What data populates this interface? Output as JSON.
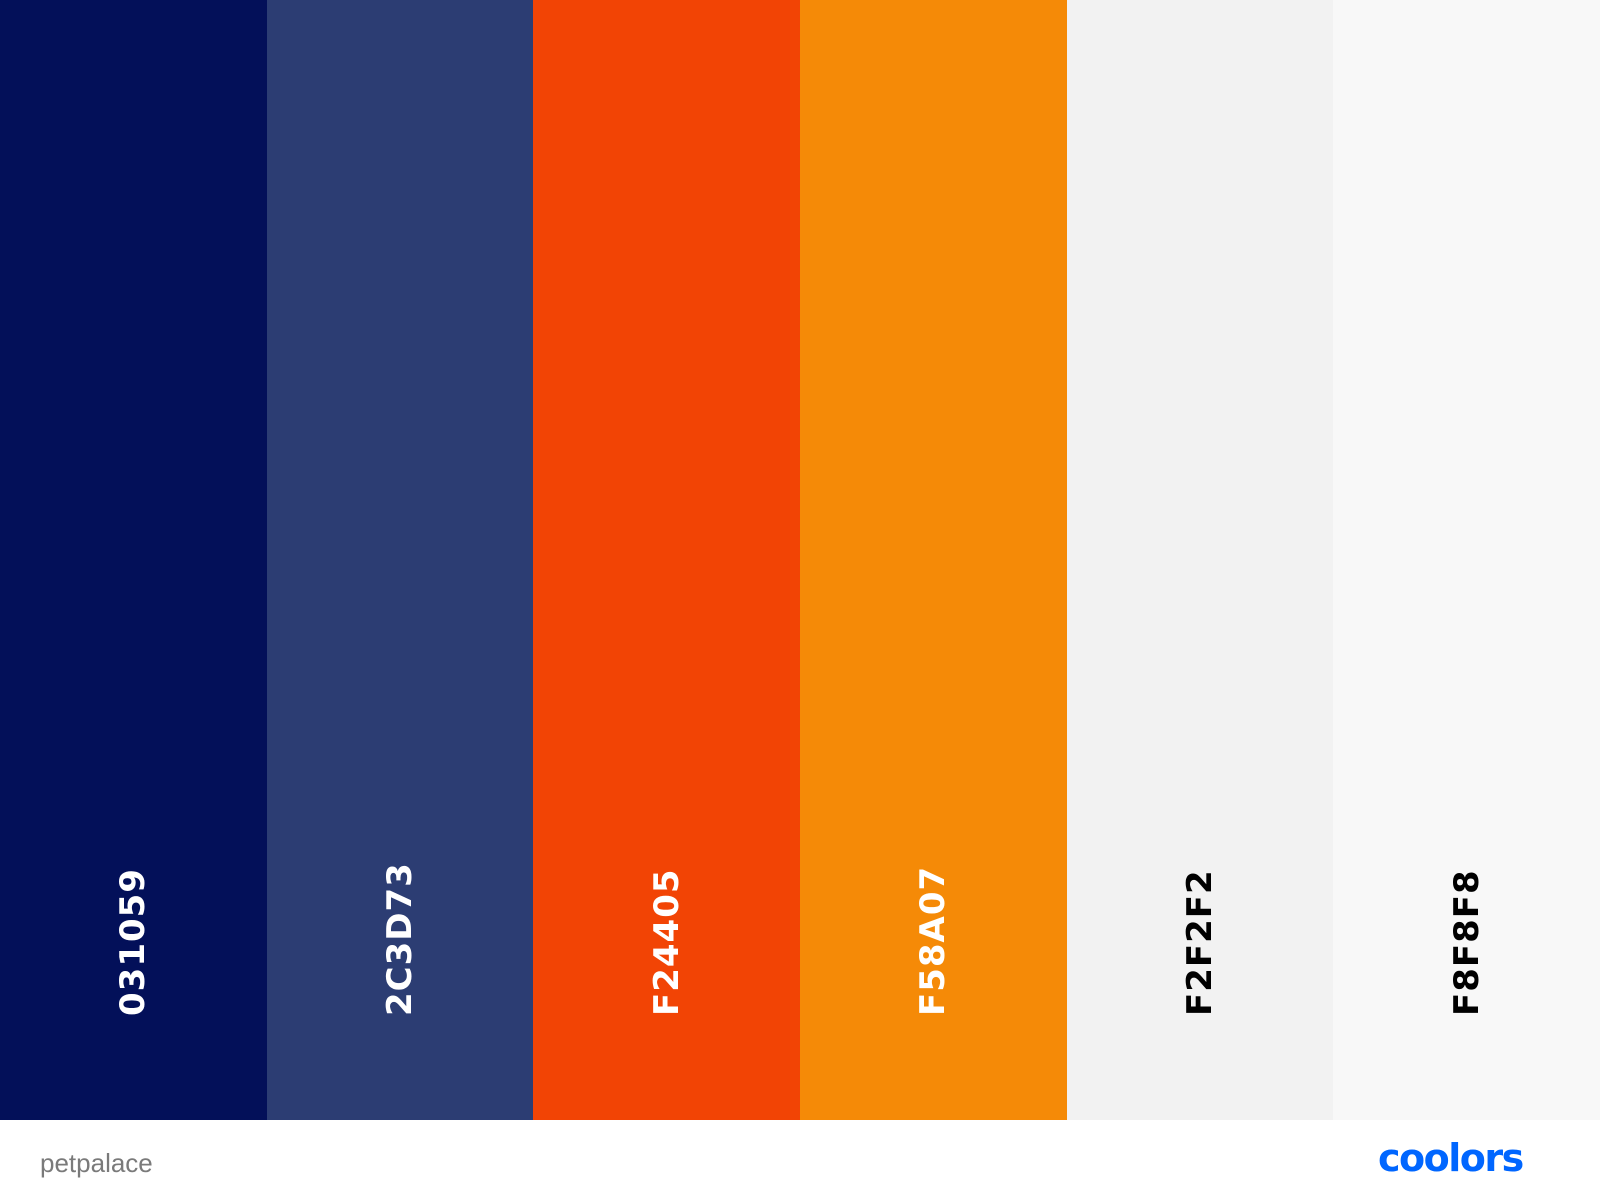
{
  "palette": {
    "swatches": [
      {
        "hex": "031059",
        "color": "#031059",
        "text_color": "#ffffff"
      },
      {
        "hex": "2C3D73",
        "color": "#2C3D73",
        "text_color": "#ffffff"
      },
      {
        "hex": "F24405",
        "color": "#F24405",
        "text_color": "#ffffff"
      },
      {
        "hex": "F58A07",
        "color": "#F58A07",
        "text_color": "#ffffff"
      },
      {
        "hex": "F2F2F2",
        "color": "#F2F2F2",
        "text_color": "#000000"
      },
      {
        "hex": "F8F8F8",
        "color": "#F8F8F8",
        "text_color": "#000000"
      }
    ]
  },
  "footer": {
    "palette_name": "petpalace",
    "logo_text": "coolors",
    "logo_color": "#0066FF",
    "logo_icon": "coolors-logo"
  }
}
